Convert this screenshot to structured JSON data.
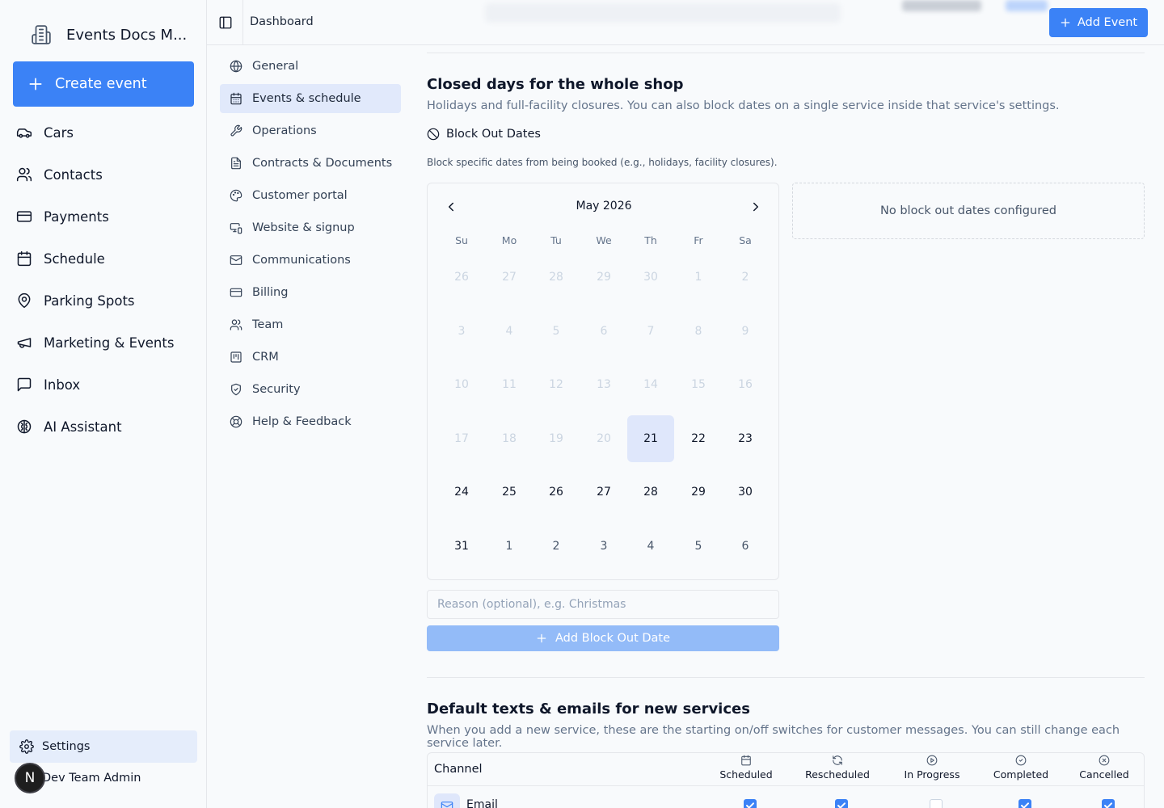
{
  "brand": {
    "name": "Events Docs M..."
  },
  "sidebar": {
    "create_label": "Create event",
    "items": [
      {
        "label": "Cars",
        "icon": "car-icon"
      },
      {
        "label": "Contacts",
        "icon": "users-icon"
      },
      {
        "label": "Payments",
        "icon": "credit-card-icon"
      },
      {
        "label": "Schedule",
        "icon": "calendar-icon"
      },
      {
        "label": "Parking Spots",
        "icon": "map-pin-icon"
      },
      {
        "label": "Marketing & Events",
        "icon": "megaphone-icon"
      },
      {
        "label": "Inbox",
        "icon": "message-square-icon"
      },
      {
        "label": "AI Assistant",
        "icon": "brain-icon"
      }
    ],
    "settings_label": "Settings",
    "user": {
      "initial": "N",
      "name": "Dev Team Admin"
    }
  },
  "topbar": {
    "breadcrumb": "Dashboard",
    "add_event_label": "Add Event"
  },
  "settings_nav": {
    "items": [
      {
        "label": "General",
        "icon": "globe-icon"
      },
      {
        "label": "Events & schedule",
        "icon": "calendar-icon",
        "active": true
      },
      {
        "label": "Operations",
        "icon": "wrench-icon"
      },
      {
        "label": "Contracts & Documents",
        "icon": "file-text-icon"
      },
      {
        "label": "Customer portal",
        "icon": "palette-icon"
      },
      {
        "label": "Website & signup",
        "icon": "monitor-smartphone-icon"
      },
      {
        "label": "Communications",
        "icon": "mail-icon"
      },
      {
        "label": "Billing",
        "icon": "credit-card-icon"
      },
      {
        "label": "Team",
        "icon": "users-icon"
      },
      {
        "label": "CRM",
        "icon": "kanban-icon"
      },
      {
        "label": "Security",
        "icon": "shield-icon"
      },
      {
        "label": "Help & Feedback",
        "icon": "life-buoy-icon"
      }
    ]
  },
  "closed_days": {
    "title": "Closed days for the whole shop",
    "description": "Holidays and full-facility closures. You can also block dates on a single service inside that service's settings.",
    "blockout_title": "Block Out Dates",
    "blockout_desc": "Block specific dates from being booked (e.g., holidays, facility closures).",
    "calendar": {
      "month_label": "May 2026",
      "weekdays": [
        "Su",
        "Mo",
        "Tu",
        "We",
        "Th",
        "Fr",
        "Sa"
      ],
      "weeks": [
        [
          "26",
          "27",
          "28",
          "29",
          "30",
          "1",
          "2"
        ],
        [
          "3",
          "4",
          "5",
          "6",
          "7",
          "8",
          "9"
        ],
        [
          "10",
          "11",
          "12",
          "13",
          "14",
          "15",
          "16"
        ],
        [
          "17",
          "18",
          "19",
          "20",
          "21",
          "22",
          "23"
        ],
        [
          "24",
          "25",
          "26",
          "27",
          "28",
          "29",
          "30"
        ],
        [
          "31",
          "1",
          "2",
          "3",
          "4",
          "5",
          "6"
        ]
      ],
      "today": "21"
    },
    "empty_text": "No block out dates configured",
    "reason_placeholder": "Reason (optional), e.g. Christmas",
    "reason_value": "",
    "add_block_label": "Add Block Out Date"
  },
  "defaults": {
    "title": "Default texts & emails for new services",
    "description": "When you add a new service, these are the starting on/off switches for customer messages. You can still change each service later.",
    "table": {
      "channel_header": "Channel",
      "columns": [
        {
          "label": "Scheduled",
          "icon": "calendar-icon"
        },
        {
          "label": "Rescheduled",
          "icon": "refresh-icon"
        },
        {
          "label": "In Progress",
          "icon": "play-circle-icon"
        },
        {
          "label": "Completed",
          "icon": "check-circle-icon"
        },
        {
          "label": "Cancelled",
          "icon": "x-circle-icon"
        }
      ],
      "rows": [
        {
          "label": "Email",
          "icon": "mail-icon",
          "values": [
            true,
            true,
            false,
            true,
            true
          ]
        }
      ]
    }
  },
  "colors": {
    "accent": "#3b82f6",
    "active_bg": "#e1e9fb",
    "muted_text": "#64748b"
  }
}
